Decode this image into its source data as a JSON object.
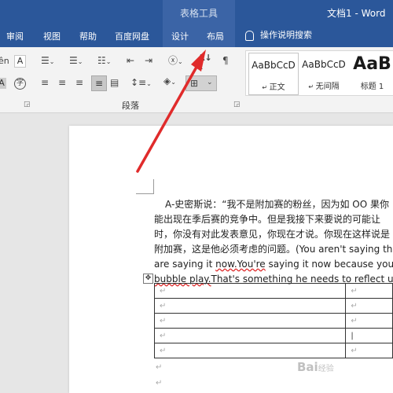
{
  "title_bar": {
    "context_label": "表格工具",
    "document_title": "文档1 - Word",
    "tabs": [
      "审阅",
      "视图",
      "帮助",
      "百度网盘",
      "设计",
      "布局"
    ],
    "tell_me": "操作说明搜索"
  },
  "ribbon": {
    "paragraph_group_label": "段落",
    "styles": [
      {
        "sample": "AaBbCcD",
        "name": "正文"
      },
      {
        "sample": "AaBbCcD",
        "name": "无间隔"
      },
      {
        "sample": "AaB",
        "name": "标题 1"
      }
    ]
  },
  "document": {
    "lines": [
      "A-史密斯说：“我不是附加赛的粉丝，因为如 OO 果你",
      "能出现在季后赛的竞争中。但是我接下来要说的可能让",
      "时，你没有对此发表意见，你现在才说。你现在这样说是",
      "附加赛，这是他必须考虑的问题。(You aren't saying this"
    ],
    "line5_before": "are saying it ",
    "line5_wavy": "now.You're",
    "line5_after": " saying it now because you find",
    "line6_wavy": "bubble play.",
    "line6_after": "That's something he needs to reflect upon.)",
    "para_mark": "↵"
  },
  "watermark": {
    "text": "Bai",
    "sub": "经验"
  },
  "colors": {
    "title_bar": "#2b579a",
    "arrow": "#e02b2b"
  }
}
